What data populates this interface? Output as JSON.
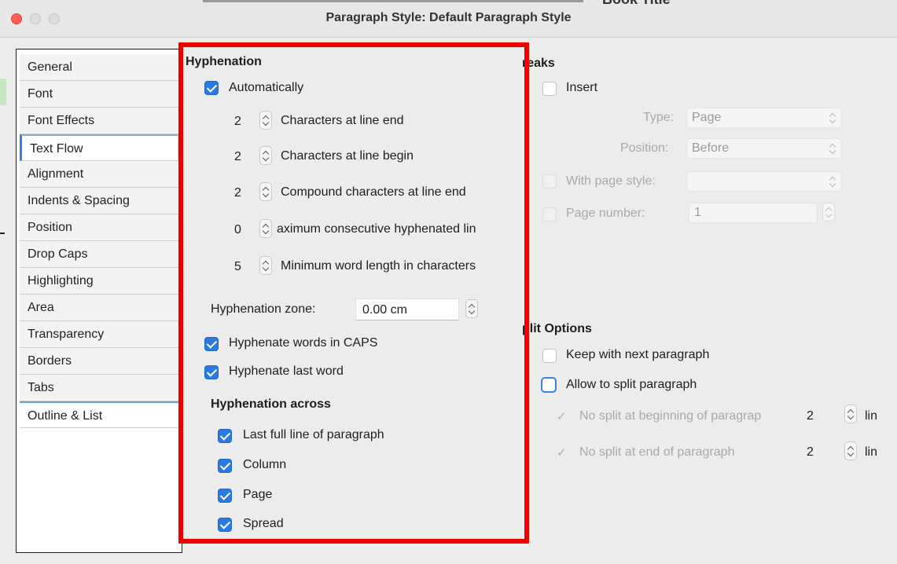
{
  "window": {
    "title": "Paragraph Style: Default Paragraph Style",
    "background_fragment": "Book Title"
  },
  "sidebar": {
    "tabs": [
      {
        "label": "General"
      },
      {
        "label": "Font"
      },
      {
        "label": "Font Effects"
      },
      {
        "label": "Text Flow"
      },
      {
        "label": "Alignment"
      },
      {
        "label": "Indents & Spacing"
      },
      {
        "label": "Position"
      },
      {
        "label": "Drop Caps"
      },
      {
        "label": "Highlighting"
      },
      {
        "label": "Area"
      },
      {
        "label": "Transparency"
      },
      {
        "label": "Borders"
      },
      {
        "label": "Tabs"
      },
      {
        "label": "Outline & List"
      }
    ],
    "active_tab": "Text Flow"
  },
  "hyphenation": {
    "heading": "Hyphenation",
    "automatically": {
      "label": "Automatically",
      "checked": true
    },
    "rows": [
      {
        "value": "2",
        "label": "Characters at line end"
      },
      {
        "value": "2",
        "label": "Characters at line begin"
      },
      {
        "value": "2",
        "label": "Compound characters at line end"
      },
      {
        "value": "0",
        "label": "aximum consecutive hyphenated lin"
      },
      {
        "value": "5",
        "label": "Minimum word length in characters"
      }
    ],
    "zone": {
      "label": "Hyphenation zone:",
      "value": "0.00 cm"
    },
    "caps": {
      "label": "Hyphenate words in CAPS",
      "checked": true
    },
    "last_word": {
      "label": "Hyphenate last word",
      "checked": true
    },
    "across": {
      "heading": "Hyphenation across",
      "items": [
        {
          "label": "Last full line of paragraph",
          "checked": true
        },
        {
          "label": "Column",
          "checked": true
        },
        {
          "label": "Page",
          "checked": true
        },
        {
          "label": "Spread",
          "checked": true
        }
      ]
    }
  },
  "breaks": {
    "heading": "Breaks",
    "heading_visible": "reaks",
    "insert": {
      "label": "Insert",
      "checked": false
    },
    "type": {
      "label": "Type:",
      "value": "Page"
    },
    "position": {
      "label": "Position:",
      "value": "Before"
    },
    "with_page_style": {
      "label": "With page style:",
      "value": ""
    },
    "page_number": {
      "label": "Page number:",
      "value": "1"
    }
  },
  "split": {
    "heading": "Split Options",
    "heading_visible": "plit Options",
    "keep_next": {
      "label": "Keep with next paragraph",
      "checked": false
    },
    "allow_split": {
      "label": "Allow to split paragraph",
      "checked": false
    },
    "no_split_begin": {
      "label": "No split at beginning of paragrap",
      "value": "2",
      "unit": "lin"
    },
    "no_split_end": {
      "label": "No split at end of paragraph",
      "value": "2",
      "unit": "lin"
    }
  },
  "colors": {
    "highlight": "#ee0000",
    "accent": "#2a7ae2"
  }
}
